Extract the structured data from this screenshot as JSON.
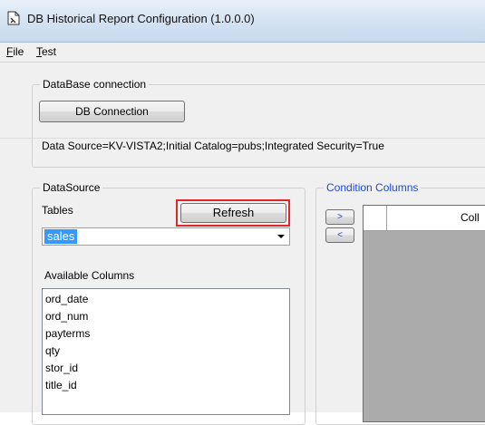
{
  "window": {
    "title": "DB Historical Report Configuration (1.0.0.0)"
  },
  "menu": {
    "file_mnemonic": "F",
    "file_rest": "ile",
    "test_mnemonic": "T",
    "test_rest": "est"
  },
  "db_group": {
    "title": "DataBase connection",
    "button_label": "DB Connection",
    "connection_string": "Data Source=KV-VISTA2;Initial Catalog=pubs;Integrated Security=True"
  },
  "datasource": {
    "title": "DataSource",
    "tables_label": "Tables",
    "refresh_label": "Refresh",
    "selected_table": "sales",
    "available_columns_label": "Available Columns",
    "columns": [
      "ord_date",
      "ord_num",
      "payterms",
      "qty",
      "stor_id",
      "title_id"
    ]
  },
  "condition": {
    "title": "Condition Columns",
    "add_label": ">",
    "remove_label": "<",
    "grid_header": "Coll"
  },
  "colors": {
    "accent": "#3399ff",
    "highlight_box": "#e0262b",
    "group_title_blue": "#1e4ad2"
  }
}
